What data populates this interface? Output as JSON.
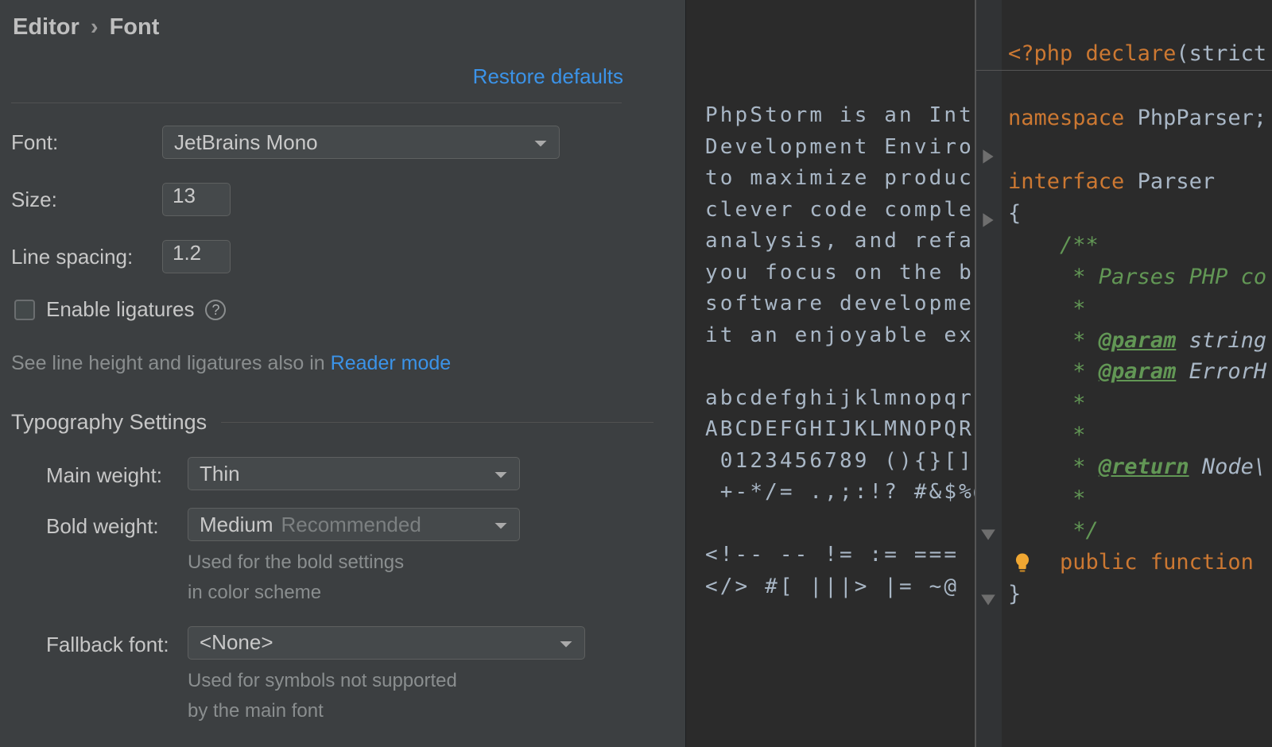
{
  "breadcrumb": {
    "parent": "Editor",
    "chevron": "›",
    "current": "Font"
  },
  "restore_defaults": "Restore defaults",
  "labels": {
    "font": "Font:",
    "size": "Size:",
    "line_spacing": "Line spacing:",
    "enable_ligatures": "Enable ligatures",
    "hint_prefix": "See line height and ligatures also in ",
    "reader_mode": "Reader mode",
    "typography_settings": "Typography Settings",
    "main_weight": "Main weight:",
    "bold_weight": "Bold weight:",
    "fallback_font": "Fallback font:",
    "bold_hint_l1": "Used for the bold settings",
    "bold_hint_l2": "in color scheme",
    "fallback_hint_l1": "Used for symbols not supported",
    "fallback_hint_l2": "by the main font"
  },
  "values": {
    "font": "JetBrains Mono",
    "size": "13",
    "line_spacing": "1.2",
    "enable_ligatures": false,
    "main_weight": "Thin",
    "bold_weight": "Medium",
    "bold_weight_suffix": "Recommended",
    "fallback_font": "<None>"
  },
  "preview_text": "PhpStorm is an Integr\nDevelopment Environme\nto maximize productiv\nclever code completio\nanalysis, and refacto\nyou focus on the brig\nsoftware development \nit an enjoyable exper\n\nabcdefghijklmnopqrstu\nABCDEFGHIJKLMNOPQRSTU\n 0123456789 (){}[]\n +-*/= .,;:!? #&$%@|^\n\n<!-- -- != := === >=\n</> #[ |||> |= ~@",
  "code": {
    "l1_a": "<?php ",
    "l1_b": "declare",
    "l1_c": "(strict",
    "l3_a": "namespace ",
    "l3_b": "PhpParser;",
    "l5_a": "interface ",
    "l5_b": "Parser",
    "l6": "{",
    "l7": "    /**",
    "l8": "     * Parses PHP co",
    "l9": "     *",
    "l10_a": "     * ",
    "l10_b": "@param",
    "l10_c": " string",
    "l11_a": "     * ",
    "l11_b": "@param",
    "l11_c": " ErrorH",
    "l12": "     *",
    "l13": "     *",
    "l14_a": "     * ",
    "l14_b": "@return",
    "l14_c": " Node\\",
    "l15": "     *",
    "l16": "     */",
    "l17_a": "    public function ",
    "l18": "}"
  }
}
